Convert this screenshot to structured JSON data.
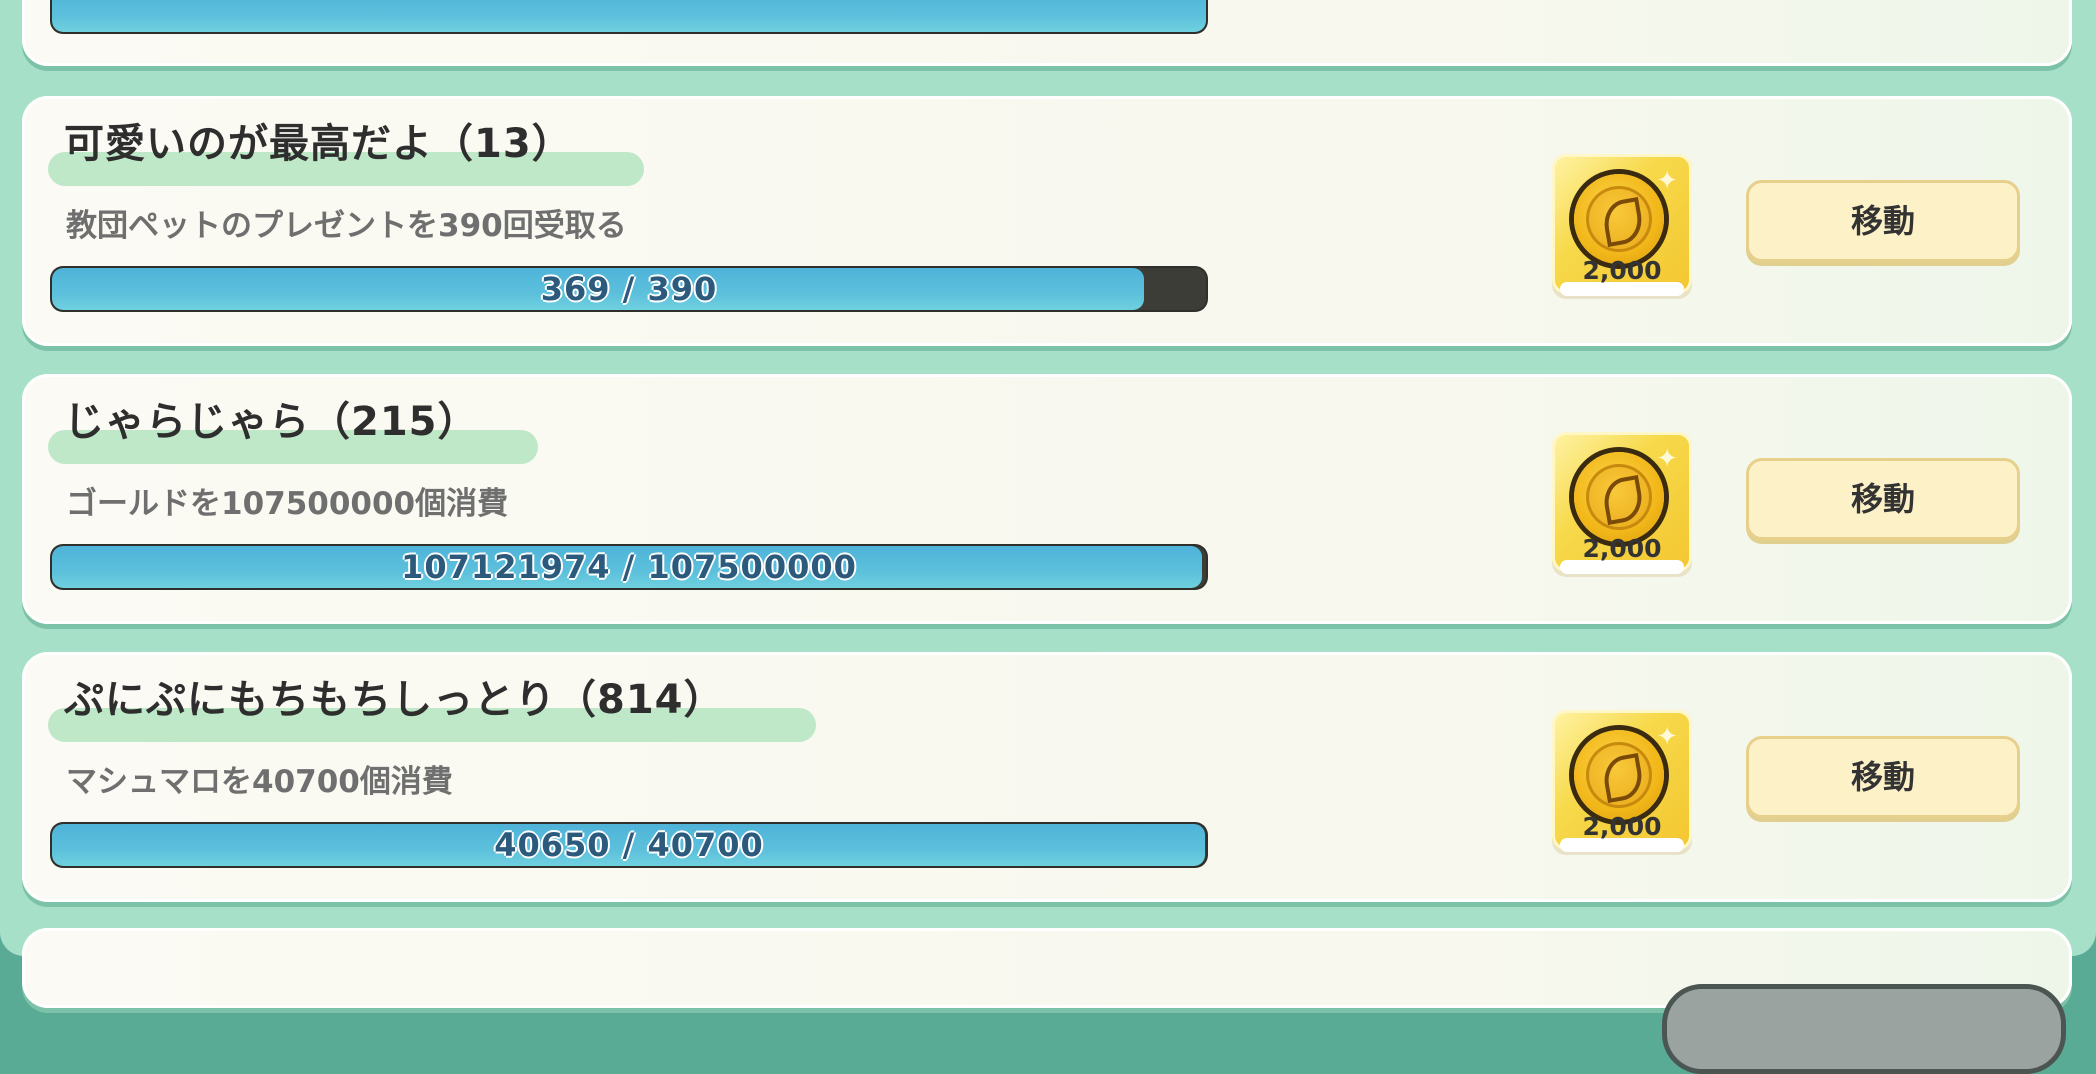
{
  "quests": [
    {
      "title": "可愛いのが最高だよ（13）",
      "description": "教団ペットのプレゼントを390回受取る",
      "progress_text": "369 / 390",
      "progress": 0.946,
      "reward_amount": "2,000",
      "reward_icon": "gold-coin-leaf-icon",
      "button_label": "移動"
    },
    {
      "title": "じゃらじゃら（215）",
      "description": "ゴールドを107500000個消費",
      "progress_text": "107121974 / 107500000",
      "progress": 0.9965,
      "reward_amount": "2,000",
      "reward_icon": "gold-coin-leaf-icon",
      "button_label": "移動"
    },
    {
      "title": "ぷにぷにもちもちしっとり（814）",
      "description": "マシュマロを40700個消費",
      "progress_text": "40650 / 40700",
      "progress": 0.9988,
      "reward_amount": "2,000",
      "reward_icon": "gold-coin-leaf-icon",
      "button_label": "移動"
    }
  ],
  "colors": {
    "panel_bg": "#a6e0c9",
    "footer_bg": "#5aab95",
    "progress_fill": "#5cc0dc",
    "progress_track": "#3b3d36",
    "button_bg": "#fdf1c8",
    "reward_bg": "#f7d94a"
  }
}
